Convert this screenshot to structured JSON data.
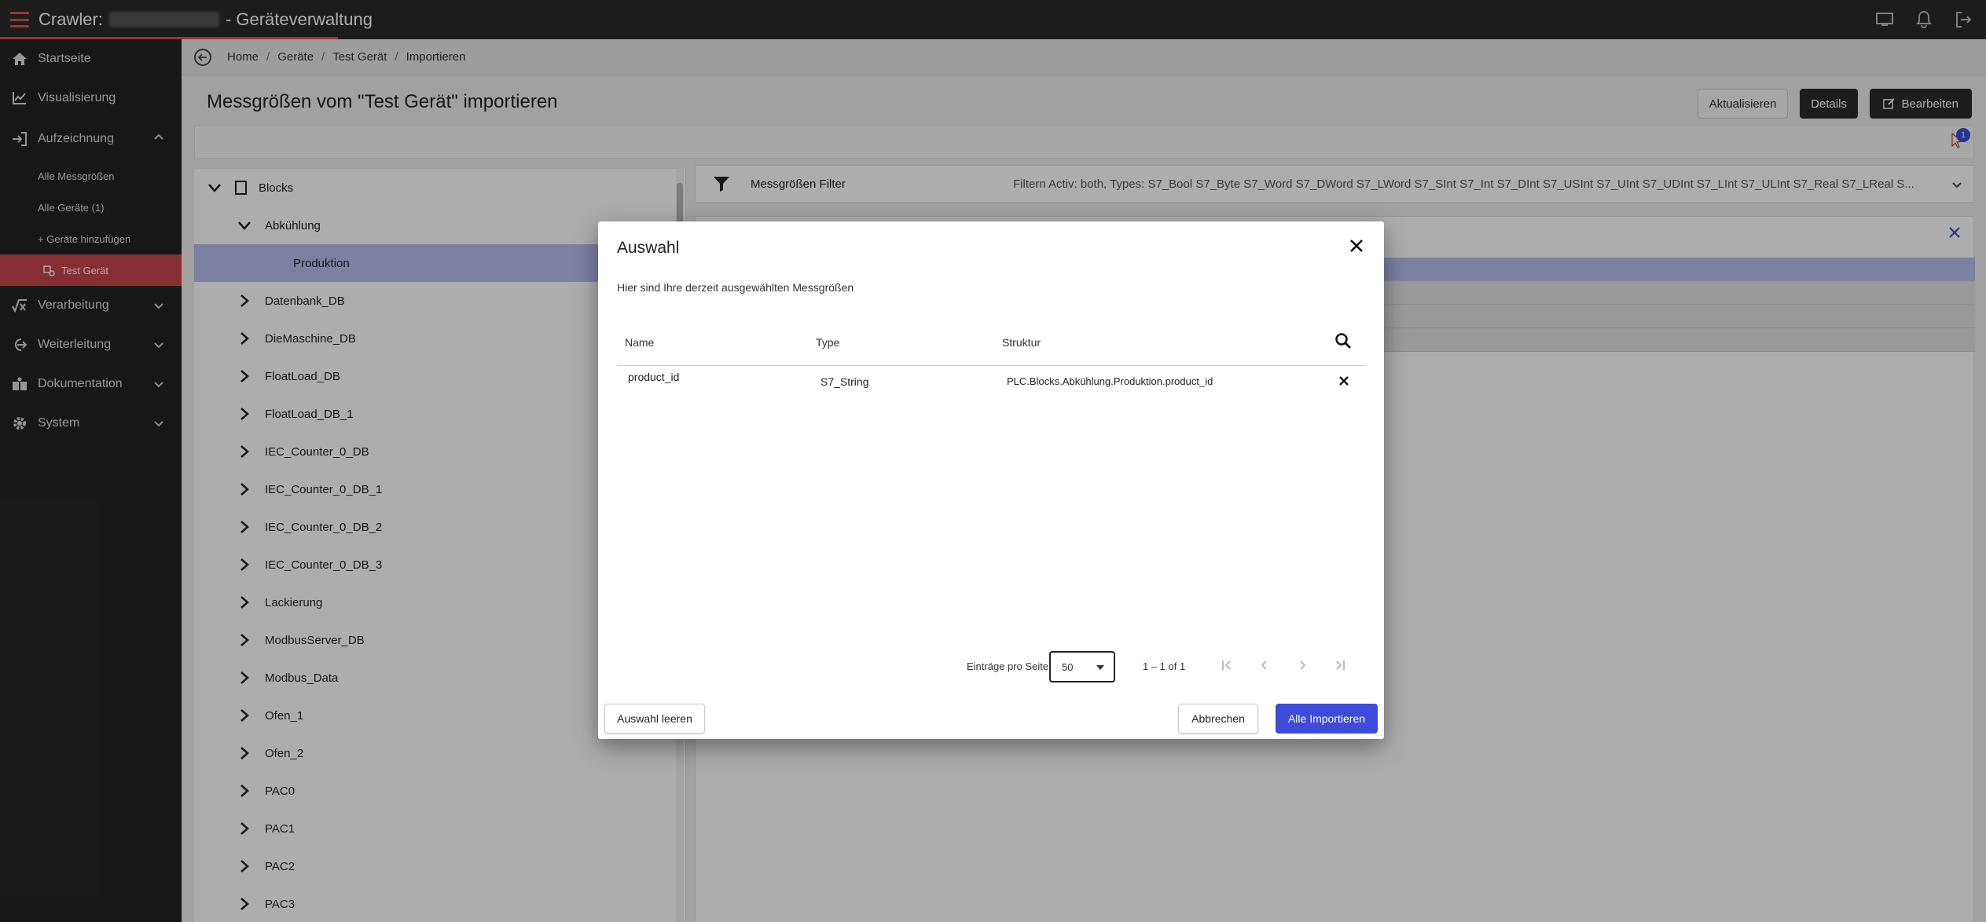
{
  "app": {
    "title_prefix": "Crawler:",
    "title_suffix": "- Geräteverwaltung"
  },
  "sidebar": {
    "items": [
      {
        "label": "Startseite",
        "icon": "home-icon"
      },
      {
        "label": "Visualisierung",
        "icon": "chart-line-icon"
      },
      {
        "label": "Aufzeichnung",
        "icon": "login-arrow-icon",
        "expanded": true
      },
      {
        "label": "Verarbeitung",
        "icon": "function-icon"
      },
      {
        "label": "Weiterleitung",
        "icon": "forward-icon"
      },
      {
        "label": "Dokumentation",
        "icon": "book-icon"
      },
      {
        "label": "System",
        "icon": "gear-icon"
      }
    ],
    "subitems": [
      {
        "label": "Alle Messgrößen"
      },
      {
        "label": "Alle Geräte (1)"
      },
      {
        "label": "+ Geräte hinzufügen"
      },
      {
        "label": "Test Gerät",
        "active": true
      }
    ]
  },
  "breadcrumb": [
    "Home",
    "Geräte",
    "Test Gerät",
    "Importieren"
  ],
  "page": {
    "title": "Messgrößen vom \"Test Gerät\" importieren",
    "buttons": {
      "refresh": "Aktualisieren",
      "details": "Details",
      "edit": "Bearbeiten"
    },
    "selection_count": "1"
  },
  "tree": {
    "root": "Blocks",
    "expanded": "Abkühlung",
    "selected": "Produktion",
    "nodes": [
      "Datenbank_DB",
      "DieMaschine_DB",
      "FloatLoad_DB",
      "FloatLoad_DB_1",
      "IEC_Counter_0_DB",
      "IEC_Counter_0_DB_1",
      "IEC_Counter_0_DB_2",
      "IEC_Counter_0_DB_3",
      "Lackierung",
      "ModbusServer_DB",
      "Modbus_Data",
      "Ofen_1",
      "Ofen_2",
      "PAC0",
      "PAC1",
      "PAC2",
      "PAC3"
    ]
  },
  "filter": {
    "label": "Messgrößen Filter",
    "summary": "Filtern Activ: both, Types: S7_Bool S7_Byte S7_Word S7_DWord S7_LWord S7_SInt S7_Int S7_DInt S7_USInt S7_UInt S7_UDInt S7_LInt S7_ULInt S7_Real S7_LReal S..."
  },
  "dialog": {
    "title": "Auswahl",
    "description": "Hier sind Ihre derzeit ausgewählten Messgrößen",
    "columns": {
      "name": "Name",
      "type": "Type",
      "structure": "Struktur"
    },
    "rows": [
      {
        "name": "product_id",
        "type": "S7_String",
        "structure": "PLC.Blocks.Abkühlung.Produktion.product_id"
      }
    ],
    "pager": {
      "label": "Einträge pro Seite",
      "page_size": "50",
      "range": "1 – 1 of 1"
    },
    "buttons": {
      "clear": "Auswahl leeren",
      "cancel": "Abbrechen",
      "import_all": "Alle Importieren"
    }
  },
  "colors": {
    "accent": "#3d4bd8",
    "sidebar_active": "#c8444c",
    "topbar": "#2a2a2a",
    "sidebar": "#232323"
  }
}
